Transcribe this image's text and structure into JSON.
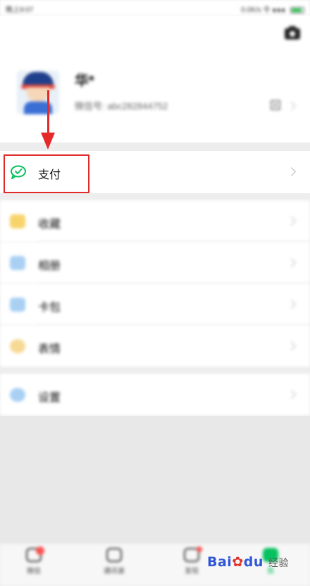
{
  "status_bar": {
    "left_text": "晚上9:07",
    "right_text": "0.0K/s 令 ∎∎∎"
  },
  "profile": {
    "nickname": "华*",
    "wechat_id": "微信号: abc282844752",
    "camera_icon": "camera-icon",
    "qr_icon": "qr-code-icon"
  },
  "menu": {
    "pay": {
      "label": "支付",
      "icon": "wechat-pay-icon"
    },
    "items": [
      {
        "label": "收藏",
        "icon": "favorites-icon",
        "color": "#f7b732"
      },
      {
        "label": "相册",
        "icon": "album-icon",
        "color": "#3d8ee8"
      },
      {
        "label": "卡包",
        "icon": "card-wallet-icon",
        "color": "#3d8ee8"
      },
      {
        "label": "表情",
        "icon": "sticker-icon",
        "color": "#f6c23e"
      }
    ],
    "settings": {
      "label": "设置",
      "icon": "settings-icon",
      "color": "#3d8ee8"
    }
  },
  "tabbar": {
    "tabs": [
      {
        "label": "微信",
        "icon": "chat-icon"
      },
      {
        "label": "通讯录",
        "icon": "contacts-icon"
      },
      {
        "label": "发现",
        "icon": "discover-icon"
      },
      {
        "label": "我",
        "icon": "me-icon"
      }
    ]
  },
  "watermark": {
    "brand": "Bai",
    "brand_suffix": "du",
    "sub": "经验"
  },
  "colors": {
    "highlight": "#e02a2a",
    "accent_green": "#07c160"
  }
}
